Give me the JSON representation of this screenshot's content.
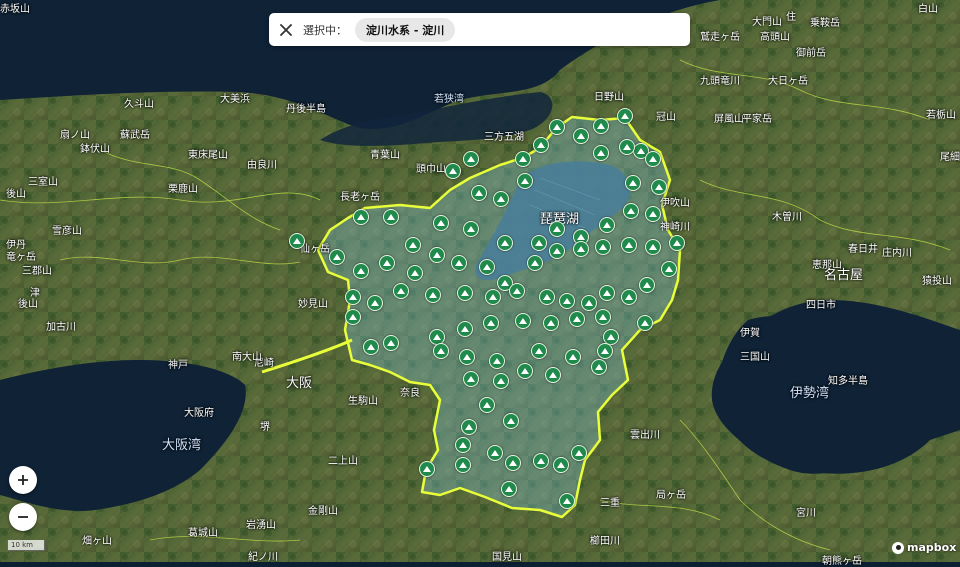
{
  "search": {
    "selecting_label": "選択中：",
    "selected_river": "淀川水系 - 淀川"
  },
  "map": {
    "places": [
      {
        "text": "大門山",
        "cls": ""
      },
      {
        "text": "住",
        "cls": ""
      },
      {
        "text": "乗鞍岳",
        "cls": ""
      },
      {
        "text": "鷲走ヶ岳",
        "cls": ""
      },
      {
        "text": "高頭山",
        "cls": ""
      },
      {
        "text": "御前岳",
        "cls": ""
      },
      {
        "text": "九頭竜川",
        "cls": ""
      },
      {
        "text": "大日ヶ岳",
        "cls": ""
      },
      {
        "text": "日野山",
        "cls": ""
      },
      {
        "text": "若狭湾",
        "cls": "water"
      },
      {
        "text": "大美浜",
        "cls": ""
      },
      {
        "text": "丹後半島",
        "cls": ""
      },
      {
        "text": "久斗山",
        "cls": ""
      },
      {
        "text": "扇ノ山",
        "cls": ""
      },
      {
        "text": "蘇武岳",
        "cls": ""
      },
      {
        "text": "鉢伏山",
        "cls": ""
      },
      {
        "text": "東床尾山",
        "cls": ""
      },
      {
        "text": "由良川",
        "cls": ""
      },
      {
        "text": "頭巾山",
        "cls": ""
      },
      {
        "text": "青葉山",
        "cls": ""
      },
      {
        "text": "栗鹿山",
        "cls": ""
      },
      {
        "text": "三室山",
        "cls": ""
      },
      {
        "text": "後山",
        "cls": ""
      },
      {
        "text": "雪彦山",
        "cls": ""
      },
      {
        "text": "長老ヶ岳",
        "cls": ""
      },
      {
        "text": "三方五湖",
        "cls": ""
      },
      {
        "text": "冠山",
        "cls": ""
      },
      {
        "text": "屏風山",
        "cls": ""
      },
      {
        "text": "平家岳",
        "cls": ""
      },
      {
        "text": "若栃山",
        "cls": ""
      },
      {
        "text": "尾細山",
        "cls": ""
      },
      {
        "text": "白山",
        "cls": ""
      },
      {
        "text": "琵琶湖",
        "cls": "big"
      },
      {
        "text": "伊吹山",
        "cls": ""
      },
      {
        "text": "木曽川",
        "cls": ""
      },
      {
        "text": "恵那山",
        "cls": ""
      },
      {
        "text": "春日井",
        "cls": ""
      },
      {
        "text": "庄内川",
        "cls": ""
      },
      {
        "text": "名古屋",
        "cls": "big"
      },
      {
        "text": "猿投山",
        "cls": ""
      },
      {
        "text": "加古川",
        "cls": ""
      },
      {
        "text": "妙見山",
        "cls": ""
      },
      {
        "text": "四日市",
        "cls": ""
      },
      {
        "text": "知多半島",
        "cls": ""
      },
      {
        "text": "伊勢湾",
        "cls": "water big"
      },
      {
        "text": "神戸",
        "cls": ""
      },
      {
        "text": "尼崎",
        "cls": ""
      },
      {
        "text": "大阪",
        "cls": "big"
      },
      {
        "text": "大阪府",
        "cls": ""
      },
      {
        "text": "大阪湾",
        "cls": "water big"
      },
      {
        "text": "生駒山",
        "cls": ""
      },
      {
        "text": "奈良",
        "cls": ""
      },
      {
        "text": "堺",
        "cls": ""
      },
      {
        "text": "二上山",
        "cls": ""
      },
      {
        "text": "雲出川",
        "cls": ""
      },
      {
        "text": "宮川",
        "cls": ""
      },
      {
        "text": "金剛山",
        "cls": ""
      },
      {
        "text": "岩湧山",
        "cls": ""
      },
      {
        "text": "葛城山",
        "cls": ""
      },
      {
        "text": "畑ヶ山",
        "cls": ""
      },
      {
        "text": "三重",
        "cls": ""
      },
      {
        "text": "局ヶ岳",
        "cls": ""
      },
      {
        "text": "櫛田川",
        "cls": ""
      },
      {
        "text": "紀ノ川",
        "cls": ""
      },
      {
        "text": "国見山",
        "cls": ""
      },
      {
        "text": "朝熊ヶ岳",
        "cls": ""
      },
      {
        "text": "津",
        "cls": ""
      },
      {
        "text": "伊賀",
        "cls": ""
      },
      {
        "text": "三国山",
        "cls": ""
      },
      {
        "text": "竜ヶ岳",
        "cls": ""
      },
      {
        "text": "後山",
        "cls": ""
      },
      {
        "text": "三郡山",
        "cls": ""
      },
      {
        "text": "南大山",
        "cls": ""
      },
      {
        "text": "伊丹",
        "cls": ""
      },
      {
        "text": "仙ヶ岳",
        "cls": ""
      },
      {
        "text": "神崎川",
        "cls": ""
      },
      {
        "text": "赤坂山",
        "cls": ""
      }
    ]
  },
  "controls": {
    "zoom_in": "+",
    "zoom_out": "−",
    "scale": "10 km"
  },
  "attribution": {
    "brand": "mapbox"
  },
  "colors": {
    "basin_outline": "#e8ff3a",
    "pin_fill": "#1f8a4c",
    "sea": "#0f2236"
  }
}
